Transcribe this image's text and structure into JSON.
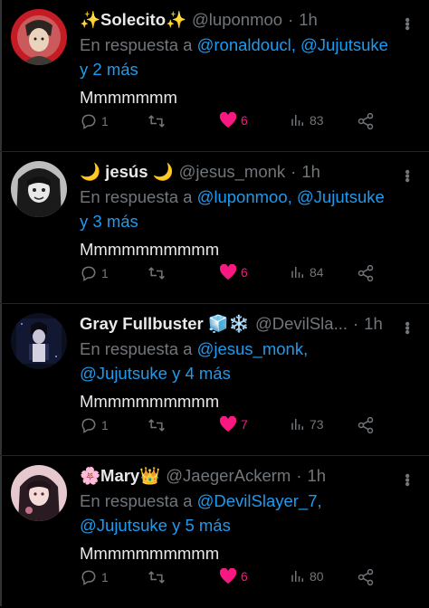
{
  "tweets": [
    {
      "display_name": "✨Solecito✨",
      "handle": "@luponmoo",
      "dot": "·",
      "time": "1h",
      "reply_prefix": "En respuesta a",
      "mentions_line1": "@ronaldoucl, @Jujutsuke",
      "mentions_line2": "y 2 más",
      "text": "Mmmmmmm",
      "replies": "1",
      "likes": "6",
      "views": "83",
      "avatar": "anime-red-background"
    },
    {
      "display_name": "🌙 jesús 🌙",
      "handle": "@jesus_monk",
      "dot": "·",
      "time": "1h",
      "reply_prefix": "En respuesta a",
      "mentions_line1": "@luponmoo, @Jujutsuke",
      "mentions_line2": "y 3 más",
      "text": "Mmmmmmmmmm",
      "replies": "1",
      "likes": "6",
      "views": "84",
      "avatar": "anime-monochrome"
    },
    {
      "display_name": "Gray Fullbuster 🧊❄️",
      "handle": "@DevilSla...",
      "dot": "·",
      "time": "1h",
      "reply_prefix": "En respuesta a",
      "mentions_line1": "@jesus_monk,",
      "mentions_line2": "@Jujutsuke y 4 más",
      "text": "Mmmmmmmmmm",
      "replies": "1",
      "likes": "7",
      "views": "73",
      "avatar": "anime-dark-blue"
    },
    {
      "display_name": "🌸Mary👑",
      "handle": "@JaegerAckerm",
      "dot": "·",
      "time": "1h",
      "reply_prefix": "En respuesta a",
      "mentions_line1": "@DevilSlayer_7,",
      "mentions_line2": "@Jujutsuke y 5 más",
      "text": "Mmmmmmmmmm",
      "replies": "1",
      "likes": "6",
      "views": "80",
      "avatar": "anime-pink"
    }
  ],
  "colors": {
    "background": "#000000",
    "text": "#e7e9ea",
    "muted": "#71767b",
    "mention": "#1d9bf0",
    "like": "#f91880"
  },
  "icons": {
    "reply": "reply-icon",
    "retweet": "retweet-icon",
    "like": "heart-icon",
    "views": "views-icon",
    "share": "share-icon",
    "more": "more-icon"
  }
}
